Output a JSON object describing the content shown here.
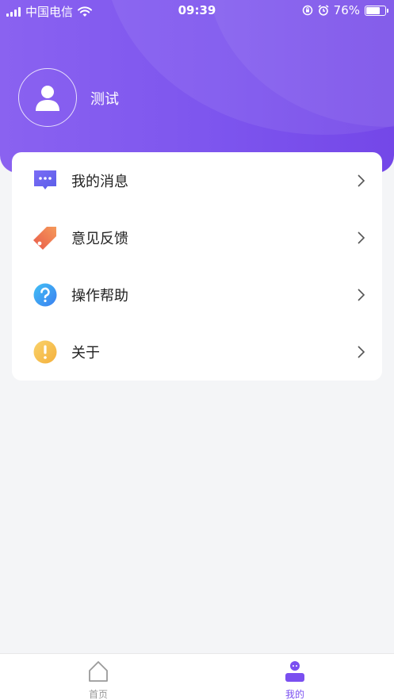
{
  "status_bar": {
    "carrier": "中国电信",
    "time": "09:39",
    "battery": "76%",
    "battery_level": 0.76,
    "icons": [
      "signal-icon",
      "wifi-icon",
      "lock-rotation-icon",
      "alarm-icon",
      "battery-icon"
    ]
  },
  "profile": {
    "username": "测试",
    "avatar_icon": "user-icon"
  },
  "menu": {
    "items": [
      {
        "label": "我的消息",
        "icon": "message-icon",
        "color": "#6c6cf0"
      },
      {
        "label": "意见反馈",
        "icon": "tag-icon",
        "color": "#f07a50"
      },
      {
        "label": "操作帮助",
        "icon": "help-icon",
        "color": "#3d8ff0"
      },
      {
        "label": "关于",
        "icon": "info-icon",
        "color": "#f5b840"
      }
    ]
  },
  "tabbar": {
    "tabs": [
      {
        "label": "首页",
        "icon": "home-icon",
        "active": false
      },
      {
        "label": "我的",
        "icon": "profile-icon",
        "active": true
      }
    ]
  },
  "colors": {
    "accent": "#7a4ff0",
    "header_start": "#8a62f0",
    "header_end": "#7447e8",
    "tab_inactive": "#999999"
  }
}
